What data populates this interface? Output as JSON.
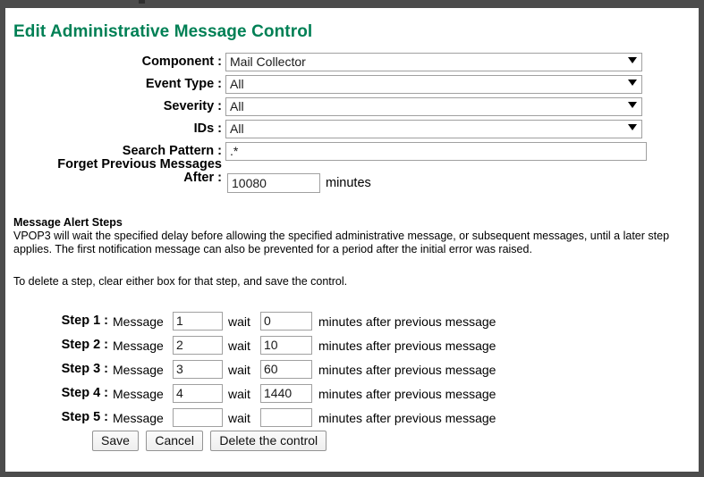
{
  "page": {
    "title": "Edit Administrative Message Control"
  },
  "form": {
    "rows": [
      {
        "label": "Component :",
        "value": "Mail Collector",
        "type": "select",
        "name": "component"
      },
      {
        "label": "Event Type :",
        "value": "All",
        "type": "select",
        "name": "event-type"
      },
      {
        "label": "Severity :",
        "value": "All",
        "type": "select",
        "name": "severity"
      },
      {
        "label": "IDs :",
        "value": "All",
        "type": "select",
        "name": "ids"
      },
      {
        "label": "Search Pattern :",
        "value": ".*",
        "type": "text",
        "name": "search-pattern"
      }
    ],
    "forget": {
      "label_line1": "Forget Previous Messages",
      "label_line2": "After :",
      "value": "10080",
      "unit": "minutes"
    }
  },
  "info": {
    "heading": "Message Alert Steps",
    "paragraph": "VPOP3 will wait the specified delay before allowing the specified administrative message, or subsequent messages, until a later step applies. The first notification message can also be prevented for a period after the initial error was raised.",
    "note": "To delete a step, clear either box for that step, and save the control."
  },
  "steps": {
    "word_message": "Message",
    "word_wait": "wait",
    "suffix": "minutes after previous message",
    "rows": [
      {
        "label": "Step 1 :",
        "message": "1",
        "wait": "0"
      },
      {
        "label": "Step 2 :",
        "message": "2",
        "wait": "10"
      },
      {
        "label": "Step 3 :",
        "message": "3",
        "wait": "60"
      },
      {
        "label": "Step 4 :",
        "message": "4",
        "wait": "1440"
      },
      {
        "label": "Step 5 :",
        "message": "",
        "wait": ""
      }
    ]
  },
  "buttons": {
    "save": "Save",
    "cancel": "Cancel",
    "delete": "Delete the control"
  },
  "colors": {
    "title_green": "#008055",
    "frame_gray": "#4c4c4c",
    "input_border": "#a0a0a0",
    "page_background": "#ffffff"
  }
}
